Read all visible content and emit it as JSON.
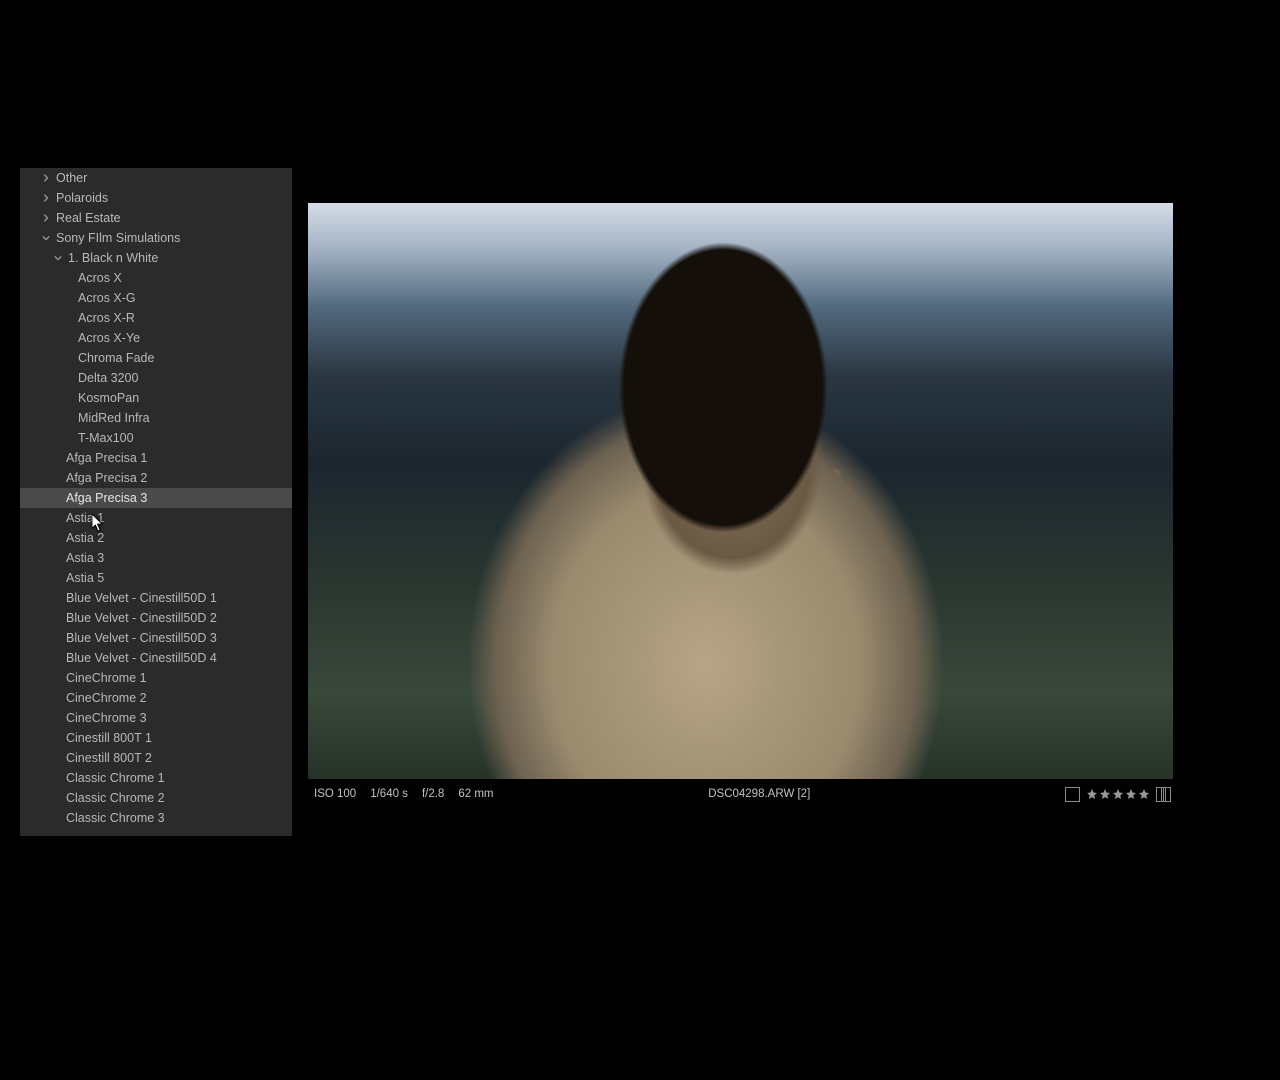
{
  "sidebar": {
    "tree": [
      {
        "kind": "folder",
        "state": "collapsed",
        "indent": 20,
        "label": "Other"
      },
      {
        "kind": "folder",
        "state": "collapsed",
        "indent": 20,
        "label": "Polaroids"
      },
      {
        "kind": "folder",
        "state": "collapsed",
        "indent": 20,
        "label": "Real Estate"
      },
      {
        "kind": "folder",
        "state": "expanded",
        "indent": 20,
        "label": "Sony FIlm Simulations"
      },
      {
        "kind": "folder",
        "state": "expanded",
        "indent": 32,
        "label": "1. Black n White"
      },
      {
        "kind": "preset",
        "indent": 58,
        "label": "Acros X"
      },
      {
        "kind": "preset",
        "indent": 58,
        "label": "Acros X-G"
      },
      {
        "kind": "preset",
        "indent": 58,
        "label": "Acros X-R"
      },
      {
        "kind": "preset",
        "indent": 58,
        "label": "Acros X-Ye"
      },
      {
        "kind": "preset",
        "indent": 58,
        "label": "Chroma Fade"
      },
      {
        "kind": "preset",
        "indent": 58,
        "label": "Delta 3200"
      },
      {
        "kind": "preset",
        "indent": 58,
        "label": "KosmoPan"
      },
      {
        "kind": "preset",
        "indent": 58,
        "label": "MidRed Infra"
      },
      {
        "kind": "preset",
        "indent": 58,
        "label": "T-Max100"
      },
      {
        "kind": "preset",
        "indent": 46,
        "label": "Afga Precisa 1"
      },
      {
        "kind": "preset",
        "indent": 46,
        "label": "Afga Precisa 2"
      },
      {
        "kind": "preset",
        "indent": 46,
        "label": "Afga Precisa 3",
        "selected": true
      },
      {
        "kind": "preset",
        "indent": 46,
        "label": "Astia 1"
      },
      {
        "kind": "preset",
        "indent": 46,
        "label": "Astia 2"
      },
      {
        "kind": "preset",
        "indent": 46,
        "label": "Astia 3"
      },
      {
        "kind": "preset",
        "indent": 46,
        "label": "Astia 5"
      },
      {
        "kind": "preset",
        "indent": 46,
        "label": "Blue Velvet - Cinestill50D 1"
      },
      {
        "kind": "preset",
        "indent": 46,
        "label": "Blue Velvet - Cinestill50D 2"
      },
      {
        "kind": "preset",
        "indent": 46,
        "label": "Blue Velvet - Cinestill50D 3"
      },
      {
        "kind": "preset",
        "indent": 46,
        "label": "Blue Velvet - Cinestill50D 4"
      },
      {
        "kind": "preset",
        "indent": 46,
        "label": "CineChrome 1"
      },
      {
        "kind": "preset",
        "indent": 46,
        "label": "CineChrome 2"
      },
      {
        "kind": "preset",
        "indent": 46,
        "label": "CineChrome 3"
      },
      {
        "kind": "preset",
        "indent": 46,
        "label": "Cinestill 800T 1"
      },
      {
        "kind": "preset",
        "indent": 46,
        "label": "Cinestill 800T 2"
      },
      {
        "kind": "preset",
        "indent": 46,
        "label": "Classic Chrome 1"
      },
      {
        "kind": "preset",
        "indent": 46,
        "label": "Classic Chrome 2"
      },
      {
        "kind": "preset",
        "indent": 46,
        "label": "Classic Chrome 3"
      }
    ],
    "cursor_over_index": 17
  },
  "exif": {
    "iso": "ISO 100",
    "shutter": "1/640 s",
    "aperture": "f/2.8",
    "focal": "62 mm"
  },
  "filename": "DSC04298.ARW [2]",
  "rating_stars": 5
}
